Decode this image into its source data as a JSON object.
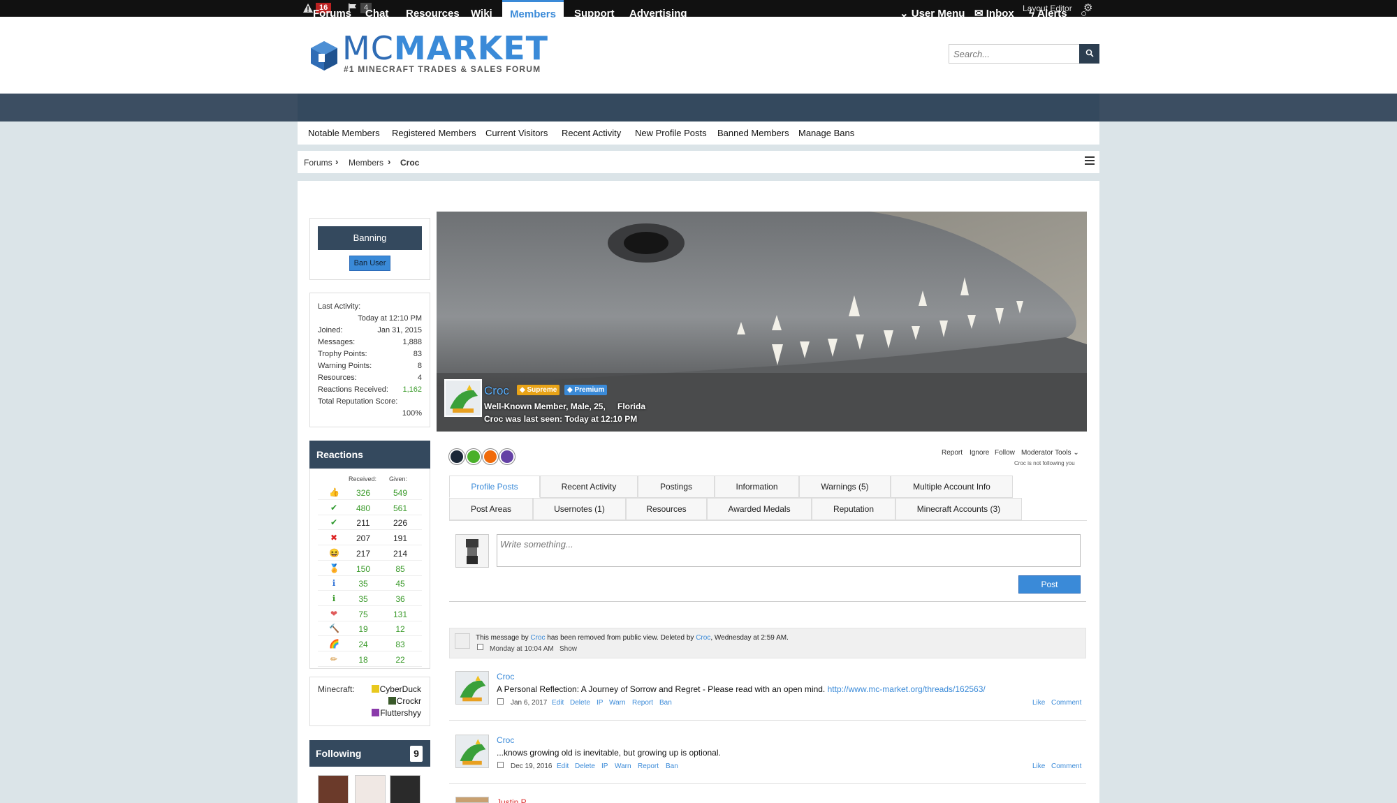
{
  "adminbar": {
    "warnings_count": "16",
    "reports_count": "4",
    "layout_editor": "Layout Editor"
  },
  "header": {
    "logo_mc": "MC",
    "logo_market": "MARKET",
    "tagline": "#1 MINECRAFT TRADES & SALES FORUM",
    "search_placeholder": "Search..."
  },
  "nav": {
    "tabs": [
      "Forums",
      "Chat",
      "Resources",
      "Wiki",
      "Members",
      "Support",
      "Advertising"
    ],
    "active": "Members",
    "right": {
      "user_menu": "User Menu",
      "inbox": "Inbox",
      "alerts": "Alerts"
    }
  },
  "subnav": [
    "Notable Members",
    "Registered Members",
    "Current Visitors",
    "Recent Activity",
    "New Profile Posts",
    "Banned Members",
    "Manage Bans"
  ],
  "breadcrumb": [
    "Forums",
    "Members",
    "Croc"
  ],
  "sidebar": {
    "banning_title": "Banning",
    "ban_user": "Ban User",
    "stats": {
      "last_activity_label": "Last Activity:",
      "last_activity": "Today at 12:10 PM",
      "joined_label": "Joined:",
      "joined": "Jan 31, 2015",
      "messages_label": "Messages:",
      "messages": "1,888",
      "trophy_label": "Trophy Points:",
      "trophy": "83",
      "warning_label": "Warning Points:",
      "warning": "8",
      "resources_label": "Resources:",
      "resources": "4",
      "reactions_label": "Reactions Received:",
      "reactions": "1,162",
      "reputation_label": "Total Reputation Score:",
      "reputation": "100%"
    },
    "reactions_title": "Reactions",
    "received_label": "Received:",
    "given_label": "Given:",
    "reactions": [
      {
        "icon": "thumbs-up-icon",
        "received": "326",
        "given": "549",
        "color": "#d9893a",
        "glyph": "👍"
      },
      {
        "icon": "check-icon",
        "received": "480",
        "given": "561",
        "color": "#2e9a2e",
        "glyph": "✔"
      },
      {
        "icon": "check-alt-icon",
        "received": "211",
        "given": "226",
        "color": "#2e9a2e",
        "glyph": "✔"
      },
      {
        "icon": "cross-icon",
        "received": "207",
        "given": "191",
        "color": "#d22",
        "glyph": "✖"
      },
      {
        "icon": "laugh-icon",
        "received": "217",
        "given": "214",
        "color": "#e6a417",
        "glyph": "😆"
      },
      {
        "icon": "trophy-icon",
        "received": "150",
        "given": "85",
        "color": "#c9a21e",
        "glyph": "🏅"
      },
      {
        "icon": "info-icon",
        "received": "35",
        "given": "45",
        "color": "#3a7ad8",
        "glyph": "ℹ"
      },
      {
        "icon": "info-green-icon",
        "received": "35",
        "given": "36",
        "color": "#3a9a2a",
        "glyph": "ℹ"
      },
      {
        "icon": "heart-icon",
        "received": "75",
        "given": "131",
        "color": "#e05a5a",
        "glyph": "❤"
      },
      {
        "icon": "hammer-icon",
        "received": "19",
        "given": "12",
        "color": "#b56a2a",
        "glyph": "🔨"
      },
      {
        "icon": "rainbow-icon",
        "received": "24",
        "given": "83",
        "color": "#e0562a",
        "glyph": "🌈"
      },
      {
        "icon": "pencil-icon",
        "received": "18",
        "given": "22",
        "color": "#d08a2a",
        "glyph": "✏"
      }
    ],
    "minecraft_label": "Minecraft:",
    "minecraft_accounts": [
      "CyberDuck",
      "Crockr",
      "Fluttershyy"
    ],
    "following_title": "Following",
    "following_count": "9"
  },
  "profile": {
    "name": "Croc",
    "badge_supreme": "Supreme",
    "badge_premium": "Premium",
    "description": "Well-Known Member, Male, 25,",
    "location": "Florida",
    "last_seen": "Croc was last seen: Today at 12:10 PM",
    "actions": [
      "Report",
      "Ignore",
      "Follow",
      "Moderator Tools"
    ],
    "not_following": "Croc is not following you"
  },
  "tabs_row1": [
    "Profile Posts",
    "Recent Activity",
    "Postings",
    "Information",
    "Warnings (5)",
    "Multiple Account Info"
  ],
  "tabs_row2": [
    "Post Areas",
    "Usernotes (1)",
    "Resources",
    "Awarded Medals",
    "Reputation",
    "Minecraft Accounts (3)"
  ],
  "composer": {
    "placeholder": "Write something...",
    "post": "Post"
  },
  "deleted_msg": {
    "prefix": "This message by",
    "author": "Croc",
    "middle": "has been removed from public view. Deleted by",
    "deleter": "Croc",
    "suffix": ", Wednesday at 2:59 AM.",
    "date": "Monday at 10:04 AM",
    "show": "Show"
  },
  "messages": [
    {
      "author": "Croc",
      "text": "A Personal Reflection: A Journey of Sorrow and Regret - Please read with an open mind.",
      "link": "http://www.mc-market.org/threads/162563/",
      "date": "Jan 6, 2017"
    },
    {
      "author": "Croc",
      "text": "...knows growing old is inevitable, but growing up is optional.",
      "link": "",
      "date": "Dec 19, 2016"
    }
  ],
  "msg_actions": [
    "Edit",
    "Delete",
    "IP",
    "Warn",
    "Report",
    "Ban"
  ],
  "msg_like": "Like",
  "msg_comment": "Comment",
  "partial_author": "Justin P."
}
